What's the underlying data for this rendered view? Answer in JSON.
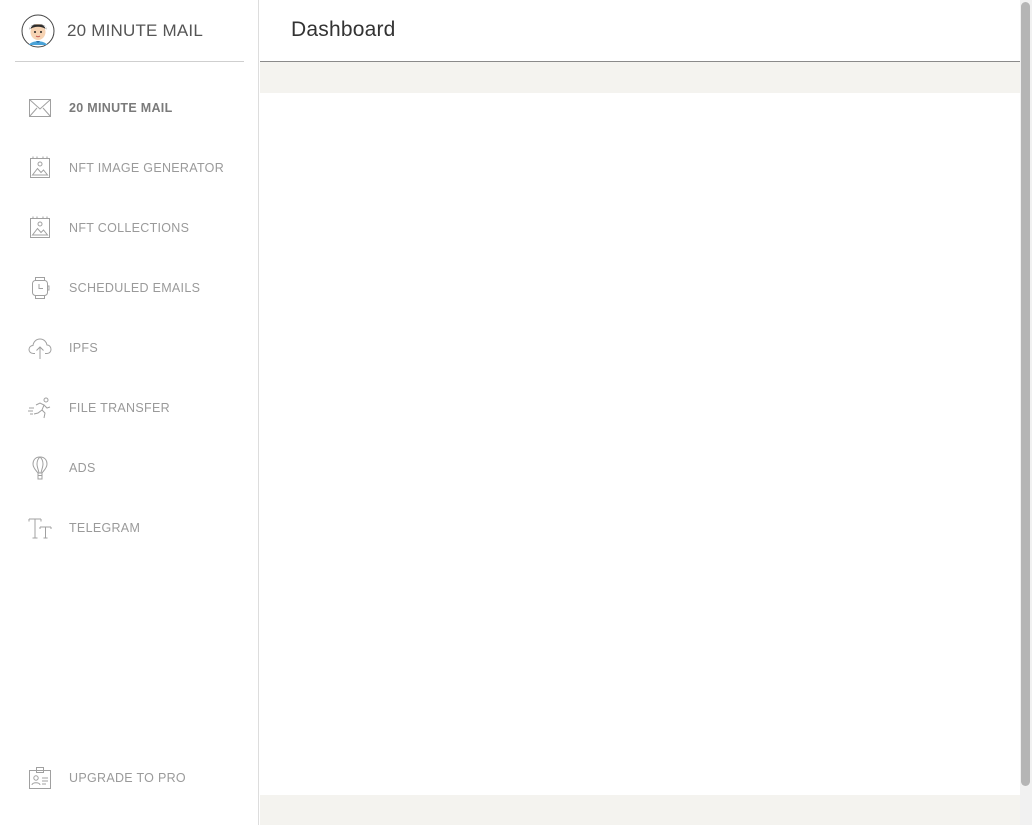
{
  "brand": {
    "title": "20 MINUTE MAIL",
    "avatar_icon": "avatar-boy-icon"
  },
  "header": {
    "title": "Dashboard"
  },
  "sidebar": {
    "items": [
      {
        "label": "20 MINUTE MAIL",
        "icon": "envelope-icon",
        "active": true
      },
      {
        "label": "NFT IMAGE GENERATOR",
        "icon": "picture-icon",
        "active": false
      },
      {
        "label": "NFT COLLECTIONS",
        "icon": "picture-icon",
        "active": false
      },
      {
        "label": "SCHEDULED EMAILS",
        "icon": "watch-icon",
        "active": false
      },
      {
        "label": "IPFS",
        "icon": "cloud-upload-icon",
        "active": false
      },
      {
        "label": "FILE TRANSFER",
        "icon": "runner-icon",
        "active": false
      },
      {
        "label": "ADS",
        "icon": "balloon-icon",
        "active": false
      },
      {
        "label": "TELEGRAM",
        "icon": "text-size-icon",
        "active": false
      }
    ],
    "upgrade": {
      "label": "UPGRADE TO PRO",
      "icon": "badge-icon"
    }
  },
  "colors": {
    "sidebar_text": "#9a9a9a",
    "active_text": "#7a7a7a",
    "strip_background": "#f4f3ef",
    "header_border": "#8a8a8a",
    "title_text": "#333333"
  }
}
